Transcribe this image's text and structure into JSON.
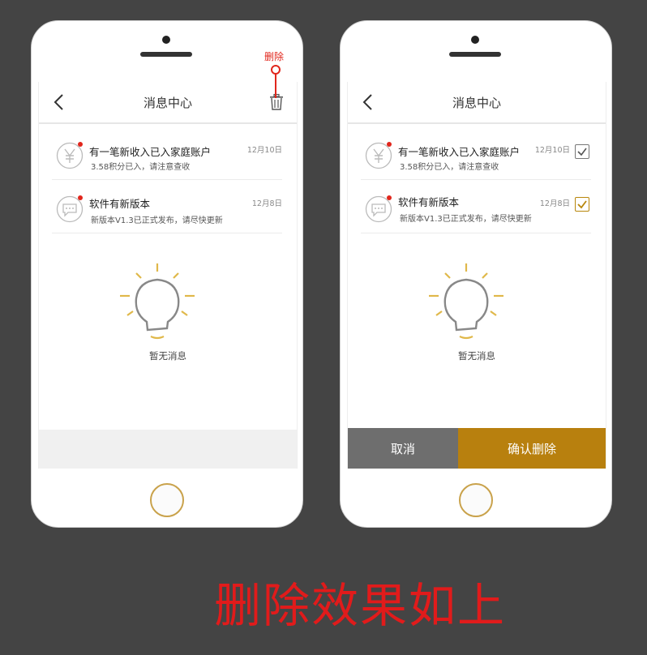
{
  "annotation": {
    "label": "删除"
  },
  "caption": "删除效果如上",
  "colors": {
    "accent": "#b8800e",
    "marker": "#e1261c",
    "background": "#444444"
  },
  "left_phone": {
    "nav": {
      "title": "消息中心",
      "back_icon": "chevron-left-icon",
      "delete_icon": "trash-icon"
    },
    "messages": [
      {
        "icon": "yen-icon",
        "title": "有一笔新收入已入家庭账户",
        "subtitle": "3.58积分已入，请注意查收",
        "date": "12月10日"
      },
      {
        "icon": "chat-icon",
        "title": "软件有新版本",
        "subtitle": "新版本V1.3已正式发布，请尽快更新",
        "date": "12月8日"
      }
    ],
    "empty_text": "暂无消息"
  },
  "right_phone": {
    "nav": {
      "title": "消息中心",
      "back_icon": "chevron-left-icon"
    },
    "messages": [
      {
        "icon": "yen-icon",
        "title": "有一笔新收入已入家庭账户",
        "subtitle": "3.58积分已入，请注意查收",
        "date": "12月10日",
        "checked": true
      },
      {
        "icon": "chat-icon",
        "title": "软件有新版本",
        "subtitle": "新版本V1.3已正式发布，请尽快更新",
        "date": "12月8日",
        "checked": true
      }
    ],
    "empty_text": "暂无消息",
    "actions": {
      "cancel_label": "取消",
      "confirm_label": "确认删除"
    }
  }
}
